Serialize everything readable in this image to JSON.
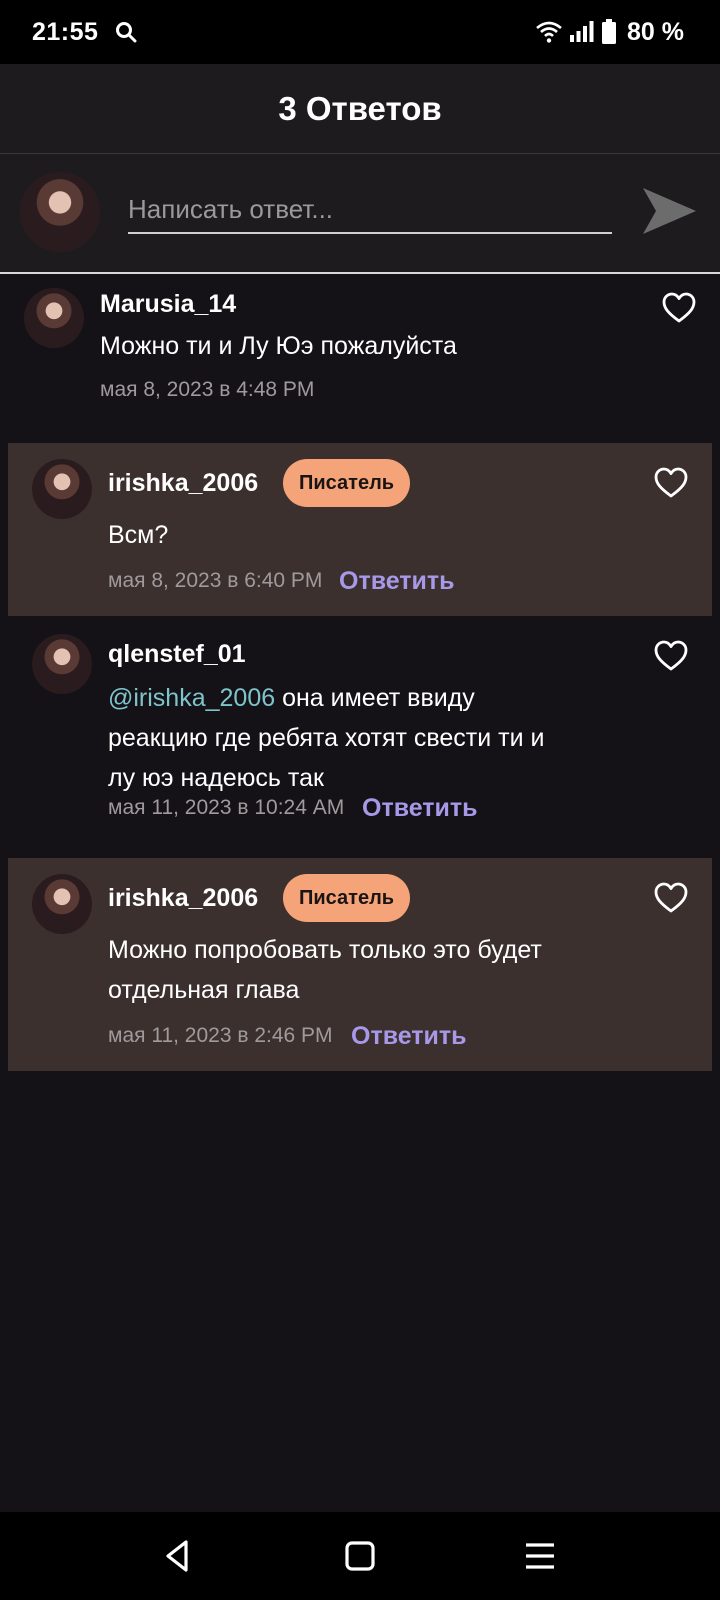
{
  "status_bar": {
    "time": "21:55",
    "battery": "80 %",
    "icons": [
      "search-icon",
      "wifi-icon",
      "signal-icon",
      "battery-icon"
    ]
  },
  "header": {
    "title": "3 Ответов"
  },
  "composer": {
    "placeholder": "Написать ответ..."
  },
  "comments": [
    {
      "username": "Marusia_14",
      "badge": "",
      "text": "Можно ти и Лу Юэ пожалуйста",
      "date": "мая 8, 2023 в 4:48 PM",
      "reply_label": "",
      "highlighted": false
    },
    {
      "username": "irishka_2006",
      "badge": "Писатель",
      "text": "Всм?",
      "date": "мая 8, 2023 в 6:40 PM",
      "reply_label": "Ответить",
      "highlighted": true
    },
    {
      "username": "qlenstef_01",
      "badge": "",
      "mention": "@irishka_2006",
      "text_line1": " она имеет ввиду",
      "text_line2": "реакцию где ребята хотят свести ти и",
      "text_line3": "лу юэ надеюсь так",
      "date": "мая 11, 2023 в 10:24 AM",
      "reply_label": "Ответить",
      "highlighted": false
    },
    {
      "username": "irishka_2006",
      "badge": "Писатель",
      "text_line1": "Можно попробовать только это будет",
      "text_line2": "отдельная глава",
      "date": "мая 11, 2023 в 2:46 PM",
      "reply_label": "Ответить",
      "highlighted": true
    }
  ],
  "colors": {
    "background": "#141216",
    "highlight": "#3b302e",
    "badge": "#f4a478",
    "reply_link": "#a898e8",
    "mention": "#7ec4cc"
  },
  "nav_bar": {
    "icons": [
      "back-icon",
      "home-icon",
      "menu-icon"
    ]
  }
}
